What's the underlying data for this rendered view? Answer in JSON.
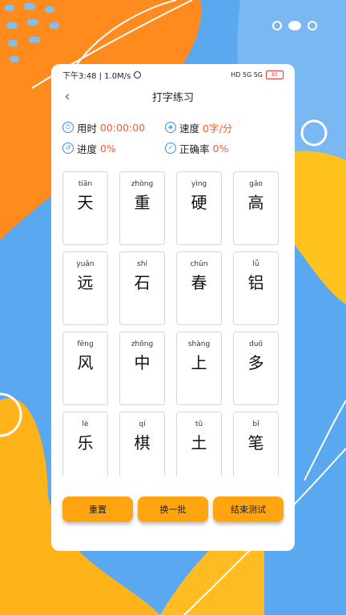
{
  "status_bar": {
    "time_speed": "下午3:48 | 1.0M/s",
    "signal": "HD 5G 5G",
    "battery": "85"
  },
  "header": {
    "title": "打字练习",
    "back_icon": "chevron-left-icon"
  },
  "stats": {
    "time_label": "用时",
    "time_value": "00:00:00",
    "speed_label": "速度",
    "speed_value": "0字/分",
    "progress_label": "进度",
    "progress_value": "0%",
    "accuracy_label": "正确率",
    "accuracy_value": "0%"
  },
  "characters": [
    {
      "pinyin": "tiān",
      "hanzi": "天"
    },
    {
      "pinyin": "zhòng",
      "hanzi": "重"
    },
    {
      "pinyin": "yìng",
      "hanzi": "硬"
    },
    {
      "pinyin": "gāo",
      "hanzi": "高"
    },
    {
      "pinyin": "yuǎn",
      "hanzi": "远"
    },
    {
      "pinyin": "shí",
      "hanzi": "石"
    },
    {
      "pinyin": "chūn",
      "hanzi": "春"
    },
    {
      "pinyin": "lǚ",
      "hanzi": "铝"
    },
    {
      "pinyin": "fēng",
      "hanzi": "风"
    },
    {
      "pinyin": "zhōng",
      "hanzi": "中"
    },
    {
      "pinyin": "shàng",
      "hanzi": "上"
    },
    {
      "pinyin": "duō",
      "hanzi": "多"
    },
    {
      "pinyin": "lè",
      "hanzi": "乐"
    },
    {
      "pinyin": "qí",
      "hanzi": "棋"
    },
    {
      "pinyin": "tǔ",
      "hanzi": "土"
    },
    {
      "pinyin": "bǐ",
      "hanzi": "笔"
    }
  ],
  "buttons": {
    "reset": "重置",
    "change": "换一批",
    "finish": "结束测试"
  },
  "colors": {
    "accent": "#ffa511",
    "value": "#ff5a2a",
    "icon": "#3a8ee6"
  }
}
